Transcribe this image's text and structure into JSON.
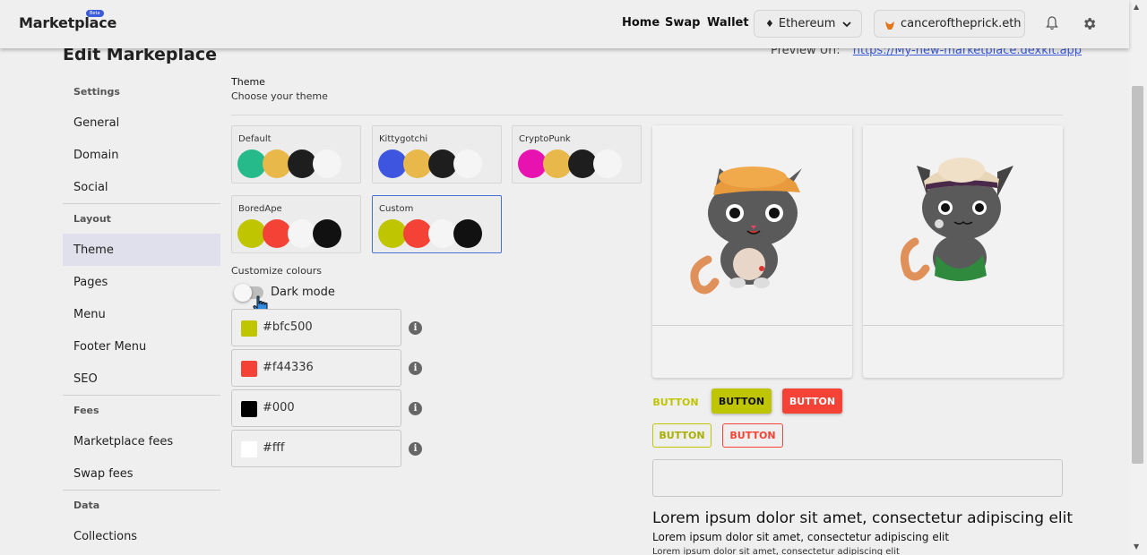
{
  "header": {
    "logo": "Marketplace",
    "beta_badge": "Beta",
    "nav": [
      "Home",
      "Swap",
      "Wallet"
    ],
    "network": "Ethereum",
    "account": "canceroftheprick.eth",
    "icons": [
      "ethereum-icon",
      "chevron-down-icon",
      "metamask-fox-icon",
      "bell-icon",
      "gear-icon"
    ]
  },
  "page": {
    "title": "Edit Markeplace",
    "preview_label": "Preview Url:",
    "preview_url": "https://My-new-marketplace.dexkit.app"
  },
  "sidebar": {
    "sections": [
      {
        "label": "Settings",
        "items": [
          "General",
          "Domain",
          "Social"
        ]
      },
      {
        "label": "Layout",
        "items": [
          "Theme",
          "Pages",
          "Menu",
          "Footer Menu",
          "SEO"
        ]
      },
      {
        "label": "Fees",
        "items": [
          "Marketplace fees",
          "Swap fees"
        ]
      },
      {
        "label": "Data",
        "items": [
          "Collections"
        ]
      }
    ],
    "active": "Theme"
  },
  "theme": {
    "title": "Theme",
    "subtitle": "Choose your theme",
    "cards": [
      {
        "name": "Default",
        "colors": [
          "#26b98a",
          "#e8b84a",
          "#1e1e1e",
          "#f5f5f5"
        ]
      },
      {
        "name": "Kittygotchi",
        "colors": [
          "#3e55e0",
          "#e8b84a",
          "#1e1e1e",
          "#f5f5f5"
        ]
      },
      {
        "name": "CryptoPunk",
        "colors": [
          "#e812b0",
          "#e8b84a",
          "#1e1e1e",
          "#f5f5f5"
        ]
      },
      {
        "name": "BoredApe",
        "colors": [
          "#bfc500",
          "#f44336",
          "#f5f5f5",
          "#111111"
        ]
      },
      {
        "name": "Custom",
        "colors": [
          "#bfc500",
          "#f44336",
          "#f5f5f5",
          "#111111"
        ]
      }
    ],
    "selected": "Custom",
    "customize_label": "Customize colours",
    "dark_mode_label": "Dark mode",
    "colors": [
      {
        "value": "#bfc500",
        "chip": "#bfc500"
      },
      {
        "value": "#f44336",
        "chip": "#f44336"
      },
      {
        "value": "#000",
        "chip": "#000000"
      },
      {
        "value": "#fff",
        "chip": "#ffffff"
      }
    ],
    "info_symbol": "i"
  },
  "preview_panel": {
    "buttons": {
      "text_primary": "BUTTON",
      "contained_primary": "BUTTON",
      "contained_secondary": "BUTTON",
      "outlined_primary": "BUTTON",
      "outlined_secondary": "BUTTON"
    },
    "lorem_heading": "Lorem ipsum dolor sit amet, consectetur adipiscing elit",
    "lorem_body1": "Lorem ipsum dolor sit amet, consectetur adipiscing elit",
    "lorem_body2": "Lorem ipsum dolor sit amet, consectetur adipiscing elit"
  },
  "colors": {
    "primary": "#bfc500",
    "secondary": "#f44336",
    "accent_link": "#3b5bdb",
    "selected_border": "#4c6fd8"
  }
}
